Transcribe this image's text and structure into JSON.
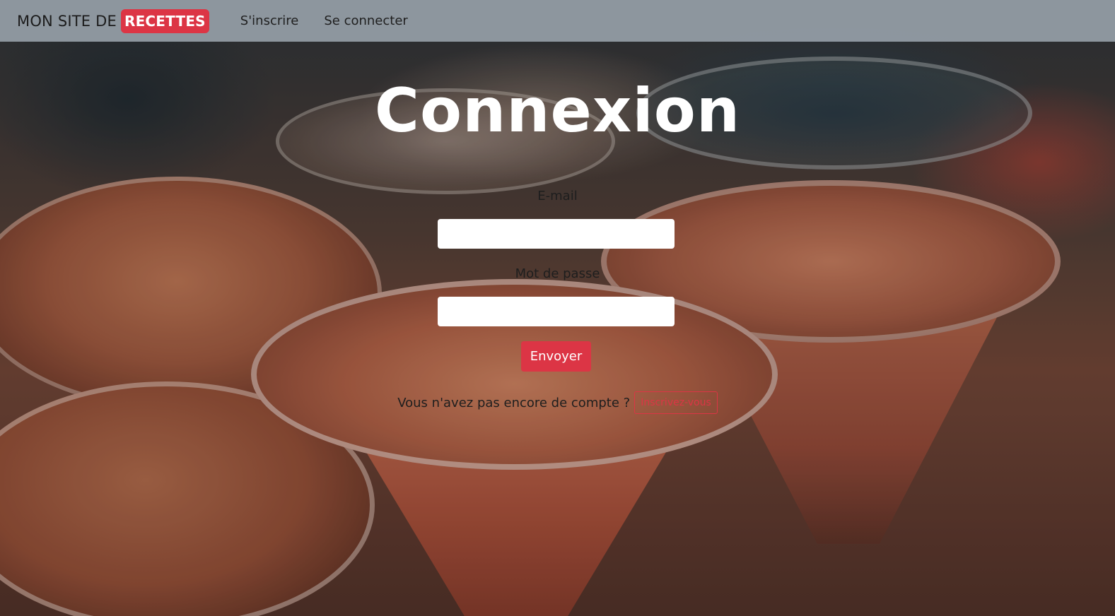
{
  "navbar": {
    "brand_prefix": "MON SITE DE",
    "brand_badge": "RECETTES",
    "links": [
      {
        "label": "S'inscrire"
      },
      {
        "label": "Se connecter"
      }
    ]
  },
  "main": {
    "title": "Connexion",
    "email_label": "E-mail",
    "email_value": "",
    "password_label": "Mot de passe",
    "password_value": "",
    "submit_label": "Envoyer",
    "signup_prompt": "Vous n'avez pas encore de compte ?",
    "signup_button": "Inscrivez-vous"
  },
  "colors": {
    "accent": "#dc3545",
    "navbar_bg": "#96a0a8",
    "title": "#ffffff"
  }
}
